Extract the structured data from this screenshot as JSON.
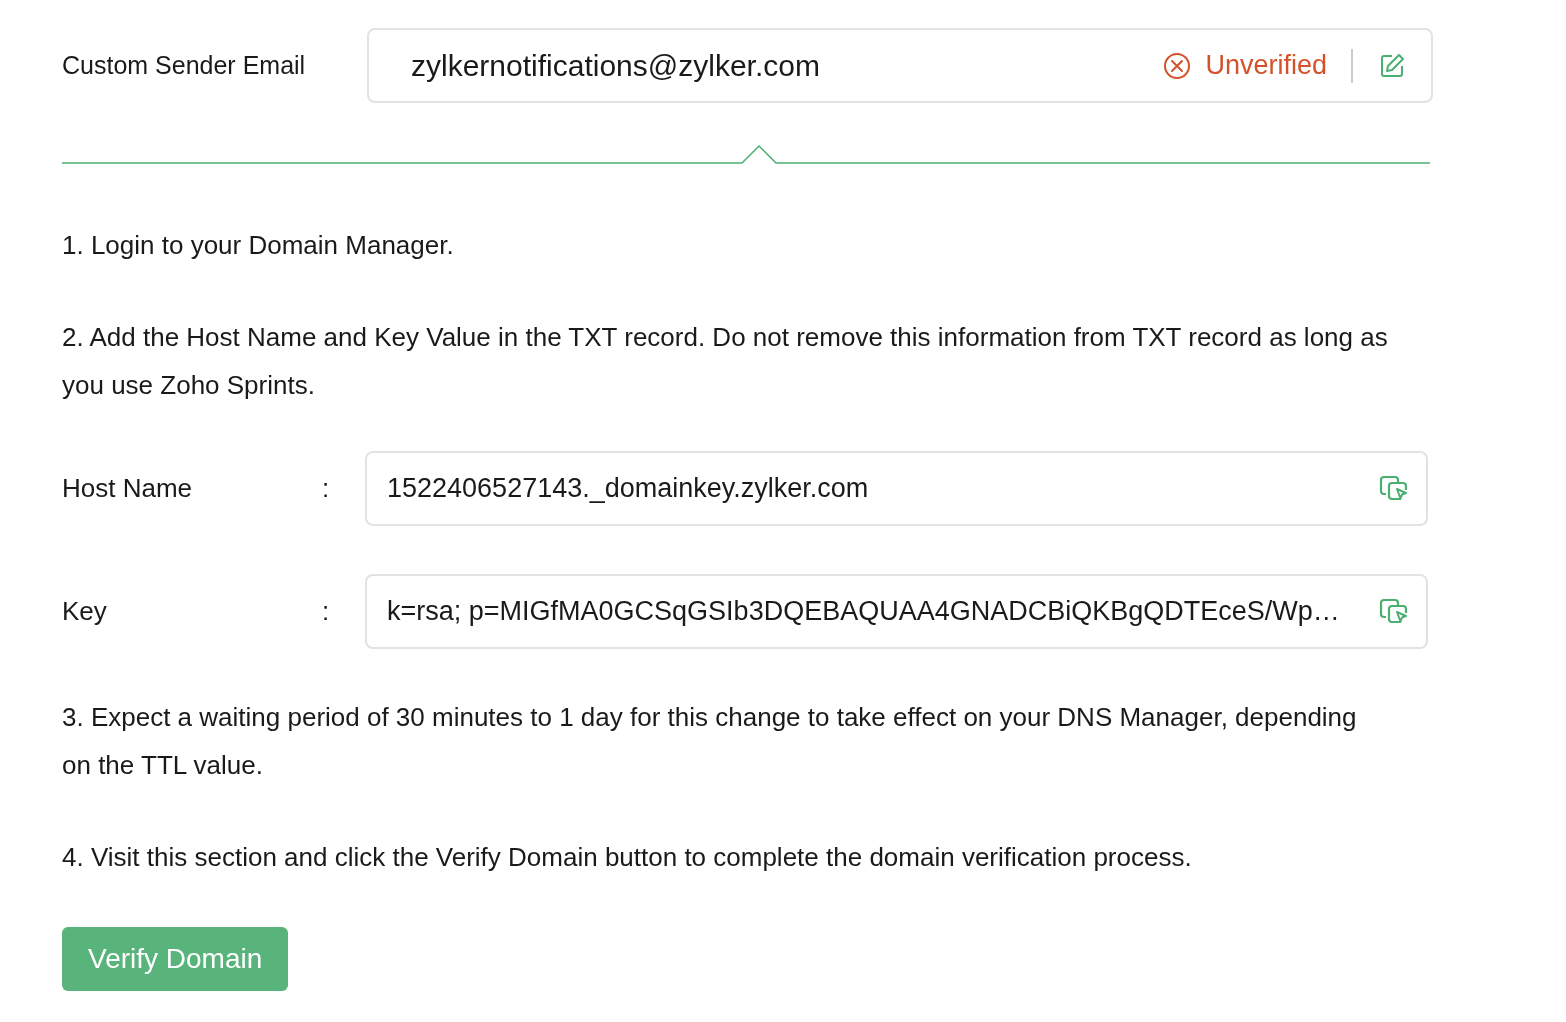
{
  "sender": {
    "label": "Custom Sender Email",
    "value": "zylkernotifications@zylker.com",
    "status": {
      "kind": "unverified",
      "label": "Unverified"
    }
  },
  "steps_before": [
    "1. Login to your Domain Manager.",
    "2. Add the Host Name and Key Value in the TXT record. Do not remove this information from TXT record as long as you use Zoho Sprints."
  ],
  "records": [
    {
      "label": "Host Name",
      "separator": ":",
      "value": "1522406527143._domainkey.zylker.com"
    },
    {
      "label": "Key",
      "separator": ":",
      "value": "k=rsa; p=MIGfMA0GCSqGSIb3DQEBAQUAA4GNADCBiQKBgQDTEceS/Wp…"
    }
  ],
  "steps_after": [
    "3. Expect a waiting period of 30 minutes to 1 day for this change to take effect on your DNS Manager, depending on the TTL value.",
    "4. Visit this section and click the Verify Domain button to complete the domain verification process."
  ],
  "button": "Verify Domain"
}
